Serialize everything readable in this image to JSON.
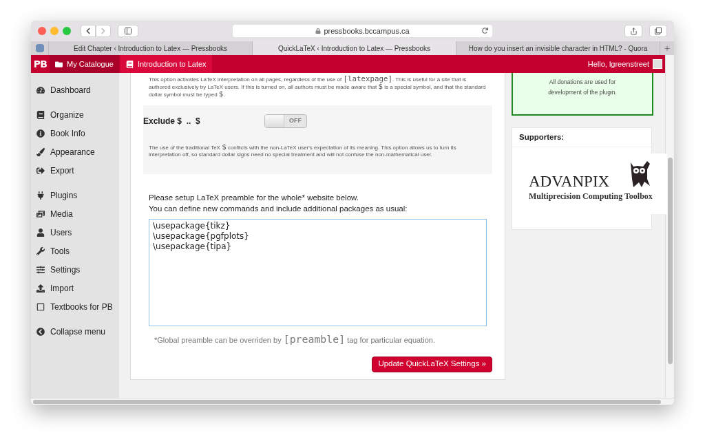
{
  "browser": {
    "url": "pressbooks.bccampus.ca",
    "tabs": [
      {
        "title": "Edit Chapter ‹ Introduction to Latex — Pressbooks",
        "selected": false
      },
      {
        "title": "QuickLaTeX ‹ Introduction to Latex — Pressbooks",
        "selected": true
      },
      {
        "title": "How do you insert an invisible character in HTML? - Quora",
        "selected": false
      }
    ],
    "new_tab": "+"
  },
  "admin_bar": {
    "logo": "PB",
    "items": [
      {
        "label": "My Catalogue",
        "kind": "folder"
      },
      {
        "label": "Introduction to Latex",
        "kind": "book"
      }
    ],
    "greeting": "Hello, lgreenstreet"
  },
  "sidebar": {
    "groups": [
      {
        "items": [
          {
            "label": "Dashboard",
            "kind": "dashboard"
          }
        ]
      },
      {
        "items": [
          {
            "label": "Organize",
            "kind": "organize"
          },
          {
            "label": "Book Info",
            "kind": "info"
          },
          {
            "label": "Appearance",
            "kind": "appearance"
          },
          {
            "label": "Export",
            "kind": "export"
          }
        ]
      },
      {
        "items": [
          {
            "label": "Plugins",
            "kind": "plugins"
          },
          {
            "label": "Media",
            "kind": "media"
          },
          {
            "label": "Users",
            "kind": "users"
          },
          {
            "label": "Tools",
            "kind": "tools"
          },
          {
            "label": "Settings",
            "kind": "settings"
          },
          {
            "label": "Import",
            "kind": "import"
          },
          {
            "label": "Textbooks for PB",
            "kind": "textbooks"
          }
        ]
      },
      {
        "items": [
          {
            "label": "Collapse menu",
            "kind": "collapse"
          }
        ]
      }
    ]
  },
  "main": {
    "intro": [
      {
        "kind": "text",
        "text": "This option activates LaTeX interpretation on all pages, regardless of the use of "
      },
      {
        "kind": "code",
        "text": "[latexpage]"
      },
      {
        "kind": "text",
        "text": ". This is useful for a site that is authored exclusively by LaTeX users. If this is turned on, all authors must be made aware that "
      },
      {
        "kind": "code",
        "text": "$"
      },
      {
        "kind": "text",
        "text": " is a special symbol, and that the standard dollar symbol must be typed "
      },
      {
        "kind": "code",
        "text": "$"
      },
      {
        "kind": "text",
        "text": "."
      }
    ],
    "exclude": {
      "label": "Exclude $  ..  $",
      "on": false,
      "toggle_label": "OFF",
      "description": [
        {
          "kind": "text",
          "text": "The use of the traditional TeX "
        },
        {
          "kind": "code",
          "text": "$"
        },
        {
          "kind": "text",
          "text": " conflicts with the non-LaTeX user's expectation of its meaning. This option allows us to turn its interpretation off, so standard dollar signs need no special treatment and will not confuse the non-mathematical user."
        }
      ]
    },
    "preamble_intro": [
      "Please setup LaTeX preamble for the whole* website below.",
      "You can define new commands and include additional packages as usual:"
    ],
    "preamble": "\\usepackage{tikz}\n\\usepackage{pgfplots}\n\\usepackage{tipa}",
    "footnote": [
      {
        "kind": "text",
        "text": "*Global preamble can be overriden by "
      },
      {
        "kind": "code",
        "text": "[preamble]"
      },
      {
        "kind": "text",
        "text": " tag for particular equation."
      }
    ],
    "submit": "Update QuickLaTeX Settings »"
  },
  "donation": {
    "lines": [
      "All donations are used for",
      "development of the plugin."
    ]
  },
  "supporters": {
    "title": "Supporters:",
    "logo_title": "ADVANPIX",
    "logo_subtitle": "Multiprecision Computing Toolbox"
  }
}
